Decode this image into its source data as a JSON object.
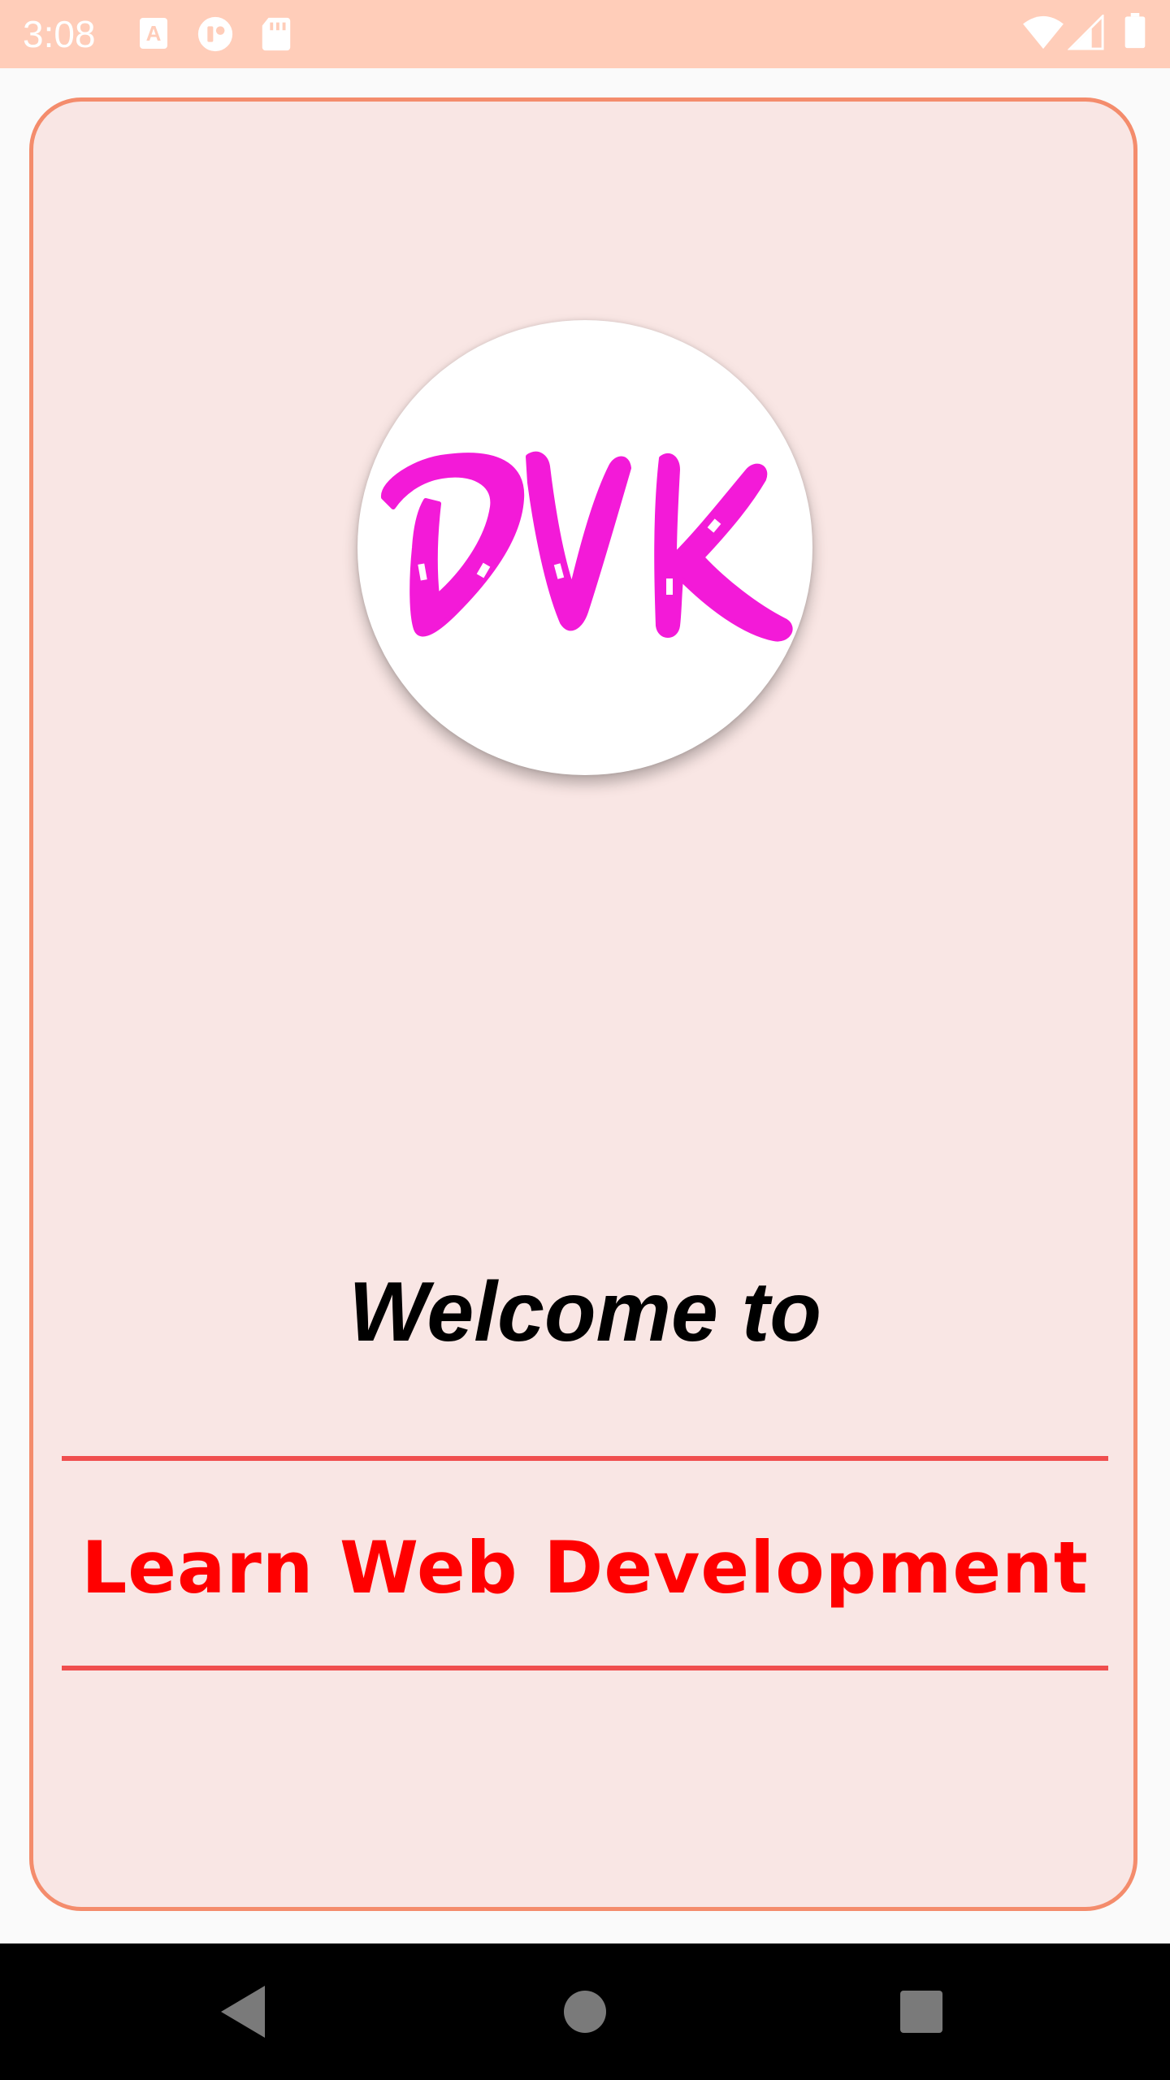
{
  "status_bar": {
    "time": "3:08",
    "background": "#ffcdb9",
    "left_icons": [
      "font-a-icon",
      "notification-app-icon",
      "sd-card-icon"
    ],
    "right_icons": [
      "wifi-icon",
      "cell-signal-icon",
      "battery-icon"
    ]
  },
  "card": {
    "border_color": "#f48c6c",
    "background": "#f9e6e4",
    "logo": {
      "text": "DVK",
      "color": "#f31ad8"
    },
    "welcome_text": "Welcome to",
    "subtitle": "Learn Web Development",
    "subtitle_color": "#ff0000",
    "divider_color": "#f04e4e"
  },
  "nav_bar": {
    "buttons": [
      "back-icon",
      "home-icon",
      "recents-icon"
    ]
  }
}
